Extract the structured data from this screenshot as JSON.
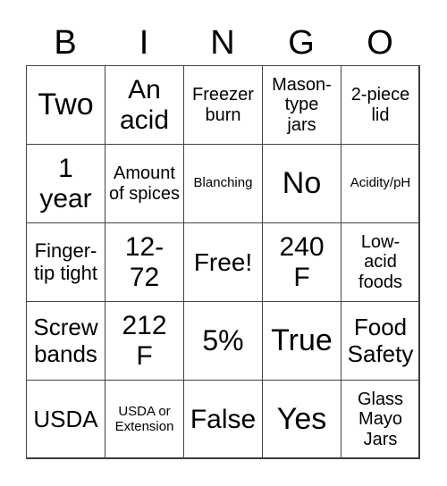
{
  "header": [
    "B",
    "I",
    "N",
    "G",
    "O"
  ],
  "cells": [
    "Two",
    "An acid",
    "Freezer burn",
    "Mason-type jars",
    "2-piece lid",
    "1 year",
    "Amount of spices",
    "Blanching",
    "No",
    "Acidity/pH",
    "Finger-tip tight",
    "12-72",
    "Free!",
    "240 F",
    "Low-acid foods",
    "Screw bands",
    "212 F",
    "5%",
    "True",
    "Food Safety",
    "USDA",
    "USDA or Extension",
    "False",
    "Yes",
    "Glass Mayo Jars"
  ]
}
